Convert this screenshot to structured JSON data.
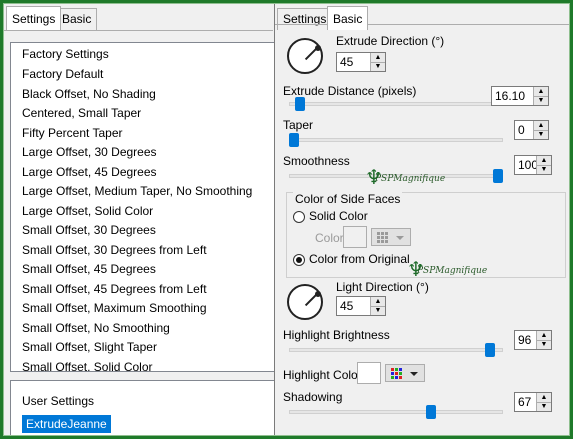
{
  "left": {
    "tabs": [
      "Settings",
      "Basic"
    ],
    "factory": {
      "header": "Factory Settings",
      "items": [
        "Factory Default",
        "Black Offset, No Shading",
        "Centered, Small Taper",
        "Fifty Percent Taper",
        "Large Offset, 30 Degrees",
        "Large Offset, 45 Degrees",
        "Large Offset, Medium Taper, No Smoothing",
        "Large Offset, Solid Color",
        "Small Offset, 30 Degrees",
        "Small Offset, 30 Degrees from Left",
        "Small Offset, 45 Degrees",
        "Small Offset, 45 Degrees from Left",
        "Small Offset, Maximum Smoothing",
        "Small Offset, No Smoothing",
        "Small Offset, Slight Taper",
        "Small Offset, Solid Color"
      ]
    },
    "user": {
      "header": "User Settings",
      "selected": "ExtrudeJeanne"
    }
  },
  "right": {
    "tabs": [
      "Settings",
      "Basic"
    ],
    "extrude_direction": {
      "label": "Extrude Direction (°)",
      "value": "45"
    },
    "extrude_distance": {
      "label": "Extrude Distance (pixels)",
      "value": "16.10",
      "level": 0.03
    },
    "taper": {
      "label": "Taper",
      "value": "0",
      "level": 0.0
    },
    "smoothness": {
      "label": "Smoothness",
      "value": "100",
      "level": 1.0
    },
    "side_faces": {
      "title": "Color of Side Faces",
      "solid_label": "Solid Color",
      "color_label": "Color",
      "original_label": "Color from Original",
      "selected": "Color from Original"
    },
    "light_direction": {
      "label": "Light Direction (°)",
      "value": "45"
    },
    "highlight_brightness": {
      "label": "Highlight Brightness",
      "value": "96",
      "level": 0.96
    },
    "highlight_color": {
      "label": "Highlight Color",
      "color": "#ffffff"
    },
    "shadowing": {
      "label": "Shadowing",
      "value": "67",
      "level": 0.67
    },
    "watermark": "PSPMagnifique"
  },
  "colors": {
    "accent": "#0078d7",
    "frame": "#1f7a2a"
  }
}
